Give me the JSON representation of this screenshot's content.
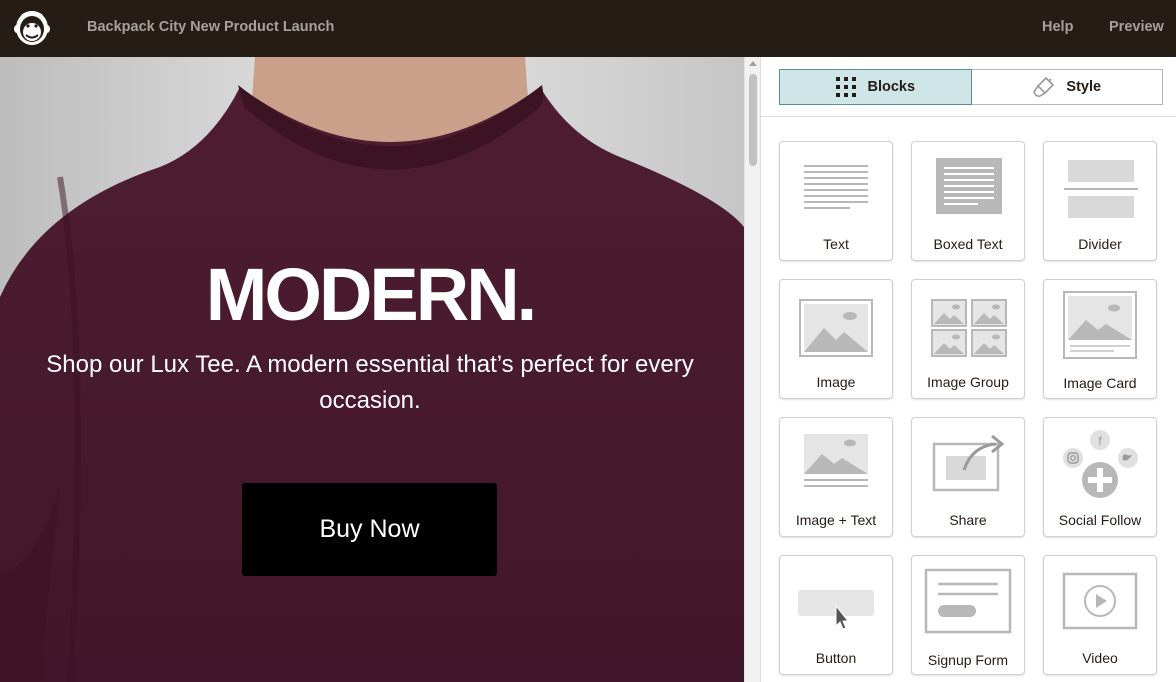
{
  "header": {
    "campaign_title": "Backpack City New Product Launch",
    "help_label": "Help",
    "preview_label": "Preview",
    "logo_icon": "mailchimp-freddie-icon"
  },
  "hero": {
    "headline": "MODERN.",
    "subtitle": "Shop our Lux Tee. A modern essential that’s perfect for every occasion.",
    "button_label": "Buy Now",
    "shirt_color": "#4a1a2c"
  },
  "panel": {
    "tabs": [
      {
        "label": "Blocks",
        "icon": "grid-dots-icon",
        "active": true
      },
      {
        "label": "Style",
        "icon": "paint-brush-icon",
        "active": false
      }
    ],
    "blocks": [
      {
        "label": "Text",
        "icon": "text-lines-icon"
      },
      {
        "label": "Boxed Text",
        "icon": "boxed-text-icon"
      },
      {
        "label": "Divider",
        "icon": "divider-icon"
      },
      {
        "label": "Image",
        "icon": "image-icon"
      },
      {
        "label": "Image Group",
        "icon": "image-group-icon"
      },
      {
        "label": "Image Card",
        "icon": "image-card-icon"
      },
      {
        "label": "Image + Text",
        "icon": "image-text-icon"
      },
      {
        "label": "Share",
        "icon": "share-icon"
      },
      {
        "label": "Social Follow",
        "icon": "social-follow-icon"
      },
      {
        "label": "Button",
        "icon": "button-cursor-icon"
      },
      {
        "label": "Signup Form",
        "icon": "signup-form-icon"
      },
      {
        "label": "Video",
        "icon": "video-play-icon"
      }
    ]
  },
  "colors": {
    "topbar": "#241c15",
    "active_tab": "#cfe6e8",
    "icon_gray": "#b8b8b8"
  }
}
